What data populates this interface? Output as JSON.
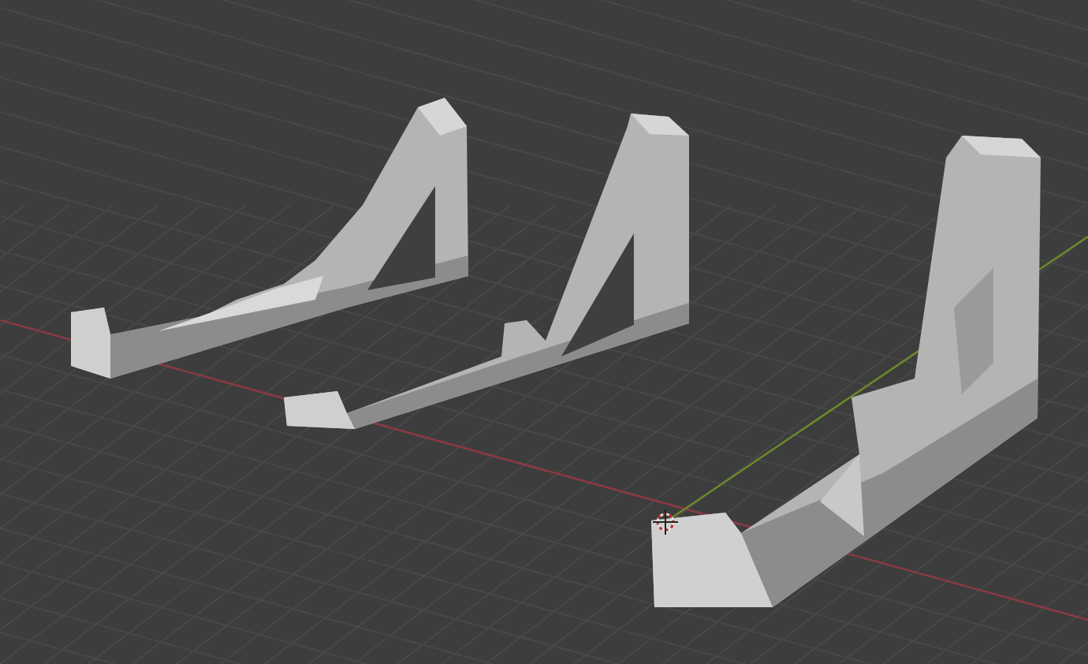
{
  "viewport": {
    "objects": [
      {
        "kind": "curved"
      },
      {
        "kind": "flat"
      },
      {
        "kind": "tall"
      }
    ]
  }
}
